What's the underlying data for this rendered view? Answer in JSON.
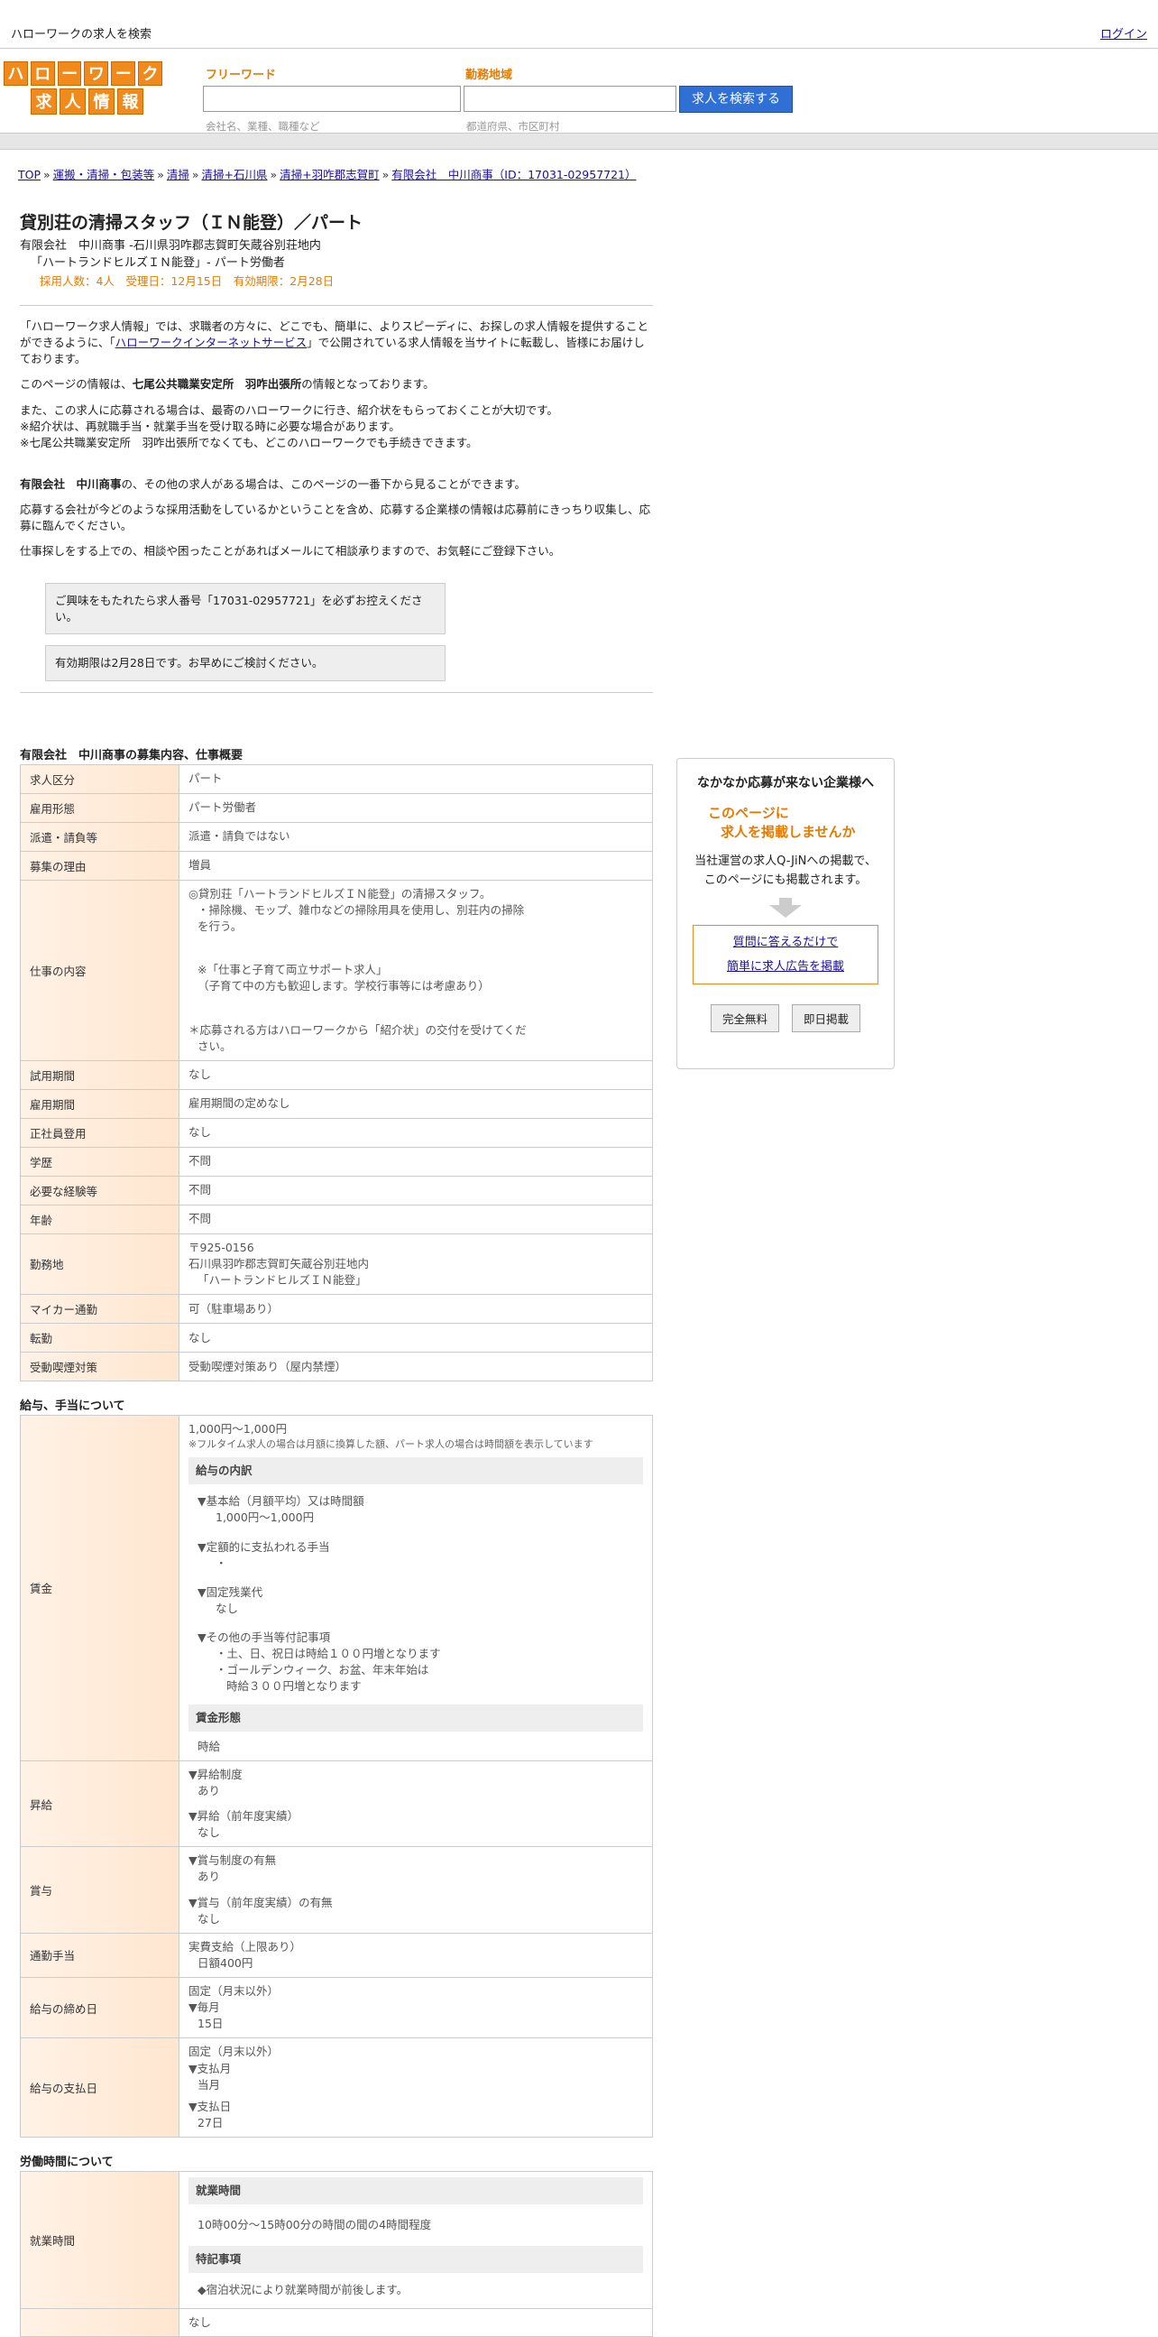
{
  "topbar": {
    "site_title": "ハローワークの求人を検索",
    "login": "ログイン"
  },
  "logo": {
    "row1": [
      "ハ",
      "ロ",
      "ー",
      "ワ",
      "ー",
      "ク"
    ],
    "row2": [
      "求",
      "人",
      "情",
      "報"
    ],
    "color": "#f08a1c"
  },
  "search": {
    "freeword_label": "フリーワード",
    "freeword_hint": "会社名、業種、職種など",
    "area_label": "勤務地域",
    "area_hint": "都道府県、市区町村",
    "button": "求人を検索する",
    "button_color": "#2f6fd6"
  },
  "breadcrumb": [
    "TOP",
    "運搬・清掃・包装等",
    "清掃",
    "清掃+石川県",
    "清掃+羽咋郡志賀町",
    "有限会社　中川商事（ID：17031-02957721）"
  ],
  "job": {
    "title": "貸別荘の清掃スタッフ（ＩＮ能登）／パート",
    "company_line": "有限会社　中川商事 -石川県羽咋郡志賀町矢蔵谷別荘地内",
    "place_line": "「ハートランドヒルズＩＮ能登」- パート労働者",
    "meta_line": "採用人数：4人　受理日：12月15日　有効期限：2月28日"
  },
  "intro": {
    "p1_a": "「ハローワーク求人情報」では、求職者の方々に、どこでも、簡単に、よりスピーディに、お探しの求人情報を提供することができるように、「",
    "p1_link": "ハローワークインターネットサービス",
    "p1_b": "」で公開されている求人情報を当サイトに転載し、皆様にお届けしております。",
    "p2_a": "このページの情報は、",
    "p2_bold": "七尾公共職業安定所　羽咋出張所",
    "p2_b": "の情報となっております。",
    "p3_l1": "また、この求人に応募される場合は、最寄のハローワークに行き、紹介状をもらっておくことが大切です。",
    "p3_l2": "※紹介状は、再就職手当・就業手当を受け取る時に必要な場合があります。",
    "p3_l3": "※七尾公共職業安定所　羽咋出張所でなくても、どこのハローワークでも手続きできます。",
    "p4_bold": "有限会社　中川商事",
    "p4_b": "の、その他の求人がある場合は、このページの一番下から見ることができます。",
    "p5": "応募する会社が今どのような採用活動をしているかということを含め、応募する企業様の情報は応募前にきっちり収集し、応募に臨んでください。",
    "p6": "仕事探しをする上での、相談や困ったことがあればメールにて相談承りますので、お気軽にご登録下さい。",
    "notice1": "ご興味をもたれたら求人番号「17031-02957721」を必ずお控えください。",
    "notice2": "有効期限は2月28日です。お早めにご検討ください。"
  },
  "summary": {
    "title": "有限会社　中川商事の募集内容、仕事概要",
    "rows": [
      {
        "h": "求人区分",
        "v": "パート"
      },
      {
        "h": "雇用形態",
        "v": "パート労働者"
      },
      {
        "h": "派遣・請負等",
        "v": "派遣・請負ではない"
      },
      {
        "h": "募集の理由",
        "v": "増員"
      }
    ],
    "work_h": "仕事の内容",
    "work_v1": "◎貸別荘「ハートランドヒルズＩＮ能登」の清掃スタッフ。",
    "work_v2": "・掃除機、モップ、雑巾などの掃除用具を使用し、別荘内の掃除",
    "work_v3": "を行う。",
    "work_v4": "※「仕事と子育て両立サポート求人」",
    "work_v5": "（子育て中の方も歓迎します。学校行事等には考慮あり）",
    "work_v6": "＊応募される方はハローワークから「紹介状」の交付を受けてくだ",
    "work_v7": "さい。",
    "rows2": [
      {
        "h": "試用期間",
        "v": "なし"
      },
      {
        "h": "雇用期間",
        "v": "雇用期間の定めなし"
      },
      {
        "h": "正社員登用",
        "v": "なし"
      },
      {
        "h": "学歴",
        "v": "不問"
      },
      {
        "h": "必要な経験等",
        "v": "不問"
      },
      {
        "h": "年齢",
        "v": "不問"
      }
    ],
    "loc_h": "勤務地",
    "loc_v1": "〒925-0156",
    "loc_v2": "石川県羽咋郡志賀町矢蔵谷別荘地内",
    "loc_v3": "「ハートランドヒルズＩＮ能登」",
    "rows3": [
      {
        "h": "マイカー通勤",
        "v": "可（駐車場あり）"
      },
      {
        "h": "転勤",
        "v": "なし"
      },
      {
        "h": "受動喫煙対策",
        "v": "受動喫煙対策あり（屋内禁煙）"
      }
    ]
  },
  "salary": {
    "title": "給与、手当について",
    "wage_h": "賃金",
    "wage_main": "1,000円〜1,000円",
    "wage_note": "※フルタイム求人の場合は月額に換算した額、パート求人の場合は時間額を表示しています",
    "breakdown_head": "給与の内訳",
    "b1": "▼基本給（月額平均）又は時間額",
    "b1v": "1,000円〜1,000円",
    "b2": "▼定額的に支払われる手当",
    "b2v": "・",
    "b3": "▼固定残業代",
    "b3v": "なし",
    "b4": "▼その他の手当等付記事項",
    "b4v1": "・土、日、祝日は時給１００円増となります",
    "b4v2": "・ゴールデンウィーク、お盆、年末年始は",
    "b4v3": "時給３００円増となります",
    "form_head": "賃金形態",
    "form_v": "時給",
    "raise_h": "昇給",
    "raise1": "▼昇給制度",
    "raise1v": "あり",
    "raise2": "▼昇給（前年度実績）",
    "raise2v": "なし",
    "bonus_h": "賞与",
    "bonus1": "▼賞与制度の有無",
    "bonus1v": "あり",
    "bonus2": "▼賞与（前年度実績）の有無",
    "bonus2v": "なし",
    "commute_h": "通勤手当",
    "commute1": "実費支給（上限あり）",
    "commute2": "日額400円",
    "close_h": "給与の締め日",
    "close1": "固定（月末以外）",
    "close2": "▼毎月",
    "close3": "15日",
    "pay_h": "給与の支払日",
    "pay1": "固定（月末以外）",
    "pay2": "▼支払月",
    "pay3": "当月",
    "pay4": "▼支払日",
    "pay5": "27日"
  },
  "hours": {
    "title": "労働時間について",
    "work_h": "就業時間",
    "head1": "就業時間",
    "v1": "10時00分〜15時00分の時間の間の4時間程度",
    "head2": "特記事項",
    "v2": "◆宿泊状況により就業時間が前後します。",
    "next_cut": "なし"
  },
  "ad": {
    "title": "なかなか応募が来ない企業様へ",
    "catch1": "このページに",
    "catch2": "求人を掲載しませんか",
    "desc1": "当社運営の求人Q-JiNへの掲載で、",
    "desc2": "このページにも掲載されます。",
    "link1": "質問に答えるだけで",
    "link2": "簡単に求人広告を掲載",
    "btn1": "完全無料",
    "btn2": "即日掲載"
  }
}
